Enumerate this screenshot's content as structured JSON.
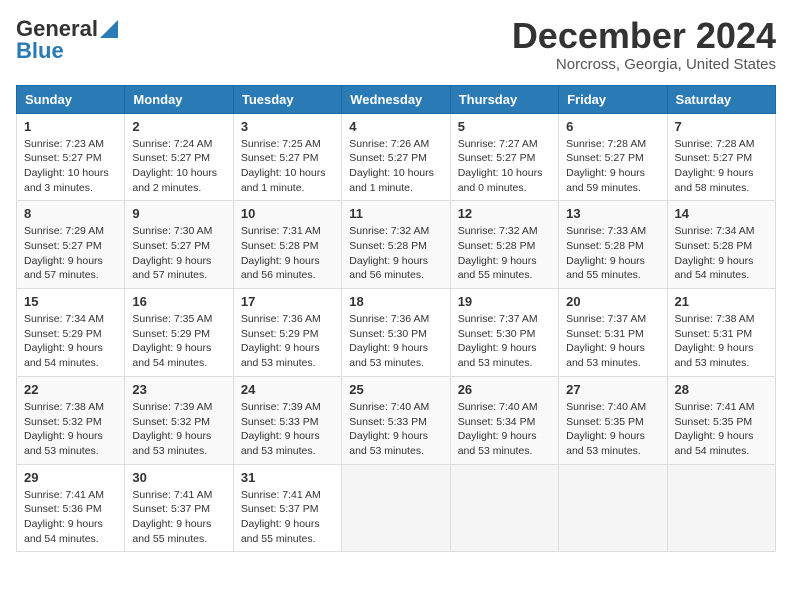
{
  "header": {
    "logo_general": "General",
    "logo_blue": "Blue",
    "month_title": "December 2024",
    "location": "Norcross, Georgia, United States"
  },
  "calendar": {
    "weekdays": [
      "Sunday",
      "Monday",
      "Tuesday",
      "Wednesday",
      "Thursday",
      "Friday",
      "Saturday"
    ],
    "weeks": [
      [
        {
          "day": "1",
          "sunrise": "Sunrise: 7:23 AM",
          "sunset": "Sunset: 5:27 PM",
          "daylight": "Daylight: 10 hours and 3 minutes."
        },
        {
          "day": "2",
          "sunrise": "Sunrise: 7:24 AM",
          "sunset": "Sunset: 5:27 PM",
          "daylight": "Daylight: 10 hours and 2 minutes."
        },
        {
          "day": "3",
          "sunrise": "Sunrise: 7:25 AM",
          "sunset": "Sunset: 5:27 PM",
          "daylight": "Daylight: 10 hours and 1 minute."
        },
        {
          "day": "4",
          "sunrise": "Sunrise: 7:26 AM",
          "sunset": "Sunset: 5:27 PM",
          "daylight": "Daylight: 10 hours and 1 minute."
        },
        {
          "day": "5",
          "sunrise": "Sunrise: 7:27 AM",
          "sunset": "Sunset: 5:27 PM",
          "daylight": "Daylight: 10 hours and 0 minutes."
        },
        {
          "day": "6",
          "sunrise": "Sunrise: 7:28 AM",
          "sunset": "Sunset: 5:27 PM",
          "daylight": "Daylight: 9 hours and 59 minutes."
        },
        {
          "day": "7",
          "sunrise": "Sunrise: 7:28 AM",
          "sunset": "Sunset: 5:27 PM",
          "daylight": "Daylight: 9 hours and 58 minutes."
        }
      ],
      [
        {
          "day": "8",
          "sunrise": "Sunrise: 7:29 AM",
          "sunset": "Sunset: 5:27 PM",
          "daylight": "Daylight: 9 hours and 57 minutes."
        },
        {
          "day": "9",
          "sunrise": "Sunrise: 7:30 AM",
          "sunset": "Sunset: 5:27 PM",
          "daylight": "Daylight: 9 hours and 57 minutes."
        },
        {
          "day": "10",
          "sunrise": "Sunrise: 7:31 AM",
          "sunset": "Sunset: 5:28 PM",
          "daylight": "Daylight: 9 hours and 56 minutes."
        },
        {
          "day": "11",
          "sunrise": "Sunrise: 7:32 AM",
          "sunset": "Sunset: 5:28 PM",
          "daylight": "Daylight: 9 hours and 56 minutes."
        },
        {
          "day": "12",
          "sunrise": "Sunrise: 7:32 AM",
          "sunset": "Sunset: 5:28 PM",
          "daylight": "Daylight: 9 hours and 55 minutes."
        },
        {
          "day": "13",
          "sunrise": "Sunrise: 7:33 AM",
          "sunset": "Sunset: 5:28 PM",
          "daylight": "Daylight: 9 hours and 55 minutes."
        },
        {
          "day": "14",
          "sunrise": "Sunrise: 7:34 AM",
          "sunset": "Sunset: 5:28 PM",
          "daylight": "Daylight: 9 hours and 54 minutes."
        }
      ],
      [
        {
          "day": "15",
          "sunrise": "Sunrise: 7:34 AM",
          "sunset": "Sunset: 5:29 PM",
          "daylight": "Daylight: 9 hours and 54 minutes."
        },
        {
          "day": "16",
          "sunrise": "Sunrise: 7:35 AM",
          "sunset": "Sunset: 5:29 PM",
          "daylight": "Daylight: 9 hours and 54 minutes."
        },
        {
          "day": "17",
          "sunrise": "Sunrise: 7:36 AM",
          "sunset": "Sunset: 5:29 PM",
          "daylight": "Daylight: 9 hours and 53 minutes."
        },
        {
          "day": "18",
          "sunrise": "Sunrise: 7:36 AM",
          "sunset": "Sunset: 5:30 PM",
          "daylight": "Daylight: 9 hours and 53 minutes."
        },
        {
          "day": "19",
          "sunrise": "Sunrise: 7:37 AM",
          "sunset": "Sunset: 5:30 PM",
          "daylight": "Daylight: 9 hours and 53 minutes."
        },
        {
          "day": "20",
          "sunrise": "Sunrise: 7:37 AM",
          "sunset": "Sunset: 5:31 PM",
          "daylight": "Daylight: 9 hours and 53 minutes."
        },
        {
          "day": "21",
          "sunrise": "Sunrise: 7:38 AM",
          "sunset": "Sunset: 5:31 PM",
          "daylight": "Daylight: 9 hours and 53 minutes."
        }
      ],
      [
        {
          "day": "22",
          "sunrise": "Sunrise: 7:38 AM",
          "sunset": "Sunset: 5:32 PM",
          "daylight": "Daylight: 9 hours and 53 minutes."
        },
        {
          "day": "23",
          "sunrise": "Sunrise: 7:39 AM",
          "sunset": "Sunset: 5:32 PM",
          "daylight": "Daylight: 9 hours and 53 minutes."
        },
        {
          "day": "24",
          "sunrise": "Sunrise: 7:39 AM",
          "sunset": "Sunset: 5:33 PM",
          "daylight": "Daylight: 9 hours and 53 minutes."
        },
        {
          "day": "25",
          "sunrise": "Sunrise: 7:40 AM",
          "sunset": "Sunset: 5:33 PM",
          "daylight": "Daylight: 9 hours and 53 minutes."
        },
        {
          "day": "26",
          "sunrise": "Sunrise: 7:40 AM",
          "sunset": "Sunset: 5:34 PM",
          "daylight": "Daylight: 9 hours and 53 minutes."
        },
        {
          "day": "27",
          "sunrise": "Sunrise: 7:40 AM",
          "sunset": "Sunset: 5:35 PM",
          "daylight": "Daylight: 9 hours and 53 minutes."
        },
        {
          "day": "28",
          "sunrise": "Sunrise: 7:41 AM",
          "sunset": "Sunset: 5:35 PM",
          "daylight": "Daylight: 9 hours and 54 minutes."
        }
      ],
      [
        {
          "day": "29",
          "sunrise": "Sunrise: 7:41 AM",
          "sunset": "Sunset: 5:36 PM",
          "daylight": "Daylight: 9 hours and 54 minutes."
        },
        {
          "day": "30",
          "sunrise": "Sunrise: 7:41 AM",
          "sunset": "Sunset: 5:37 PM",
          "daylight": "Daylight: 9 hours and 55 minutes."
        },
        {
          "day": "31",
          "sunrise": "Sunrise: 7:41 AM",
          "sunset": "Sunset: 5:37 PM",
          "daylight": "Daylight: 9 hours and 55 minutes."
        },
        null,
        null,
        null,
        null
      ]
    ]
  }
}
